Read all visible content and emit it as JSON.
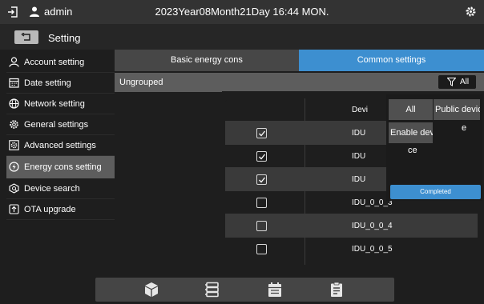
{
  "topbar": {
    "user": "admin",
    "datetime": "2023Year08Month21Day 16:44 MON."
  },
  "header": {
    "title": "Setting"
  },
  "sidebar": {
    "items": [
      {
        "label": "Account setting",
        "icon": "user-icon"
      },
      {
        "label": "Date setting",
        "icon": "calendar-icon"
      },
      {
        "label": "Network setting",
        "icon": "globe-icon"
      },
      {
        "label": "General settings",
        "icon": "gear-icon"
      },
      {
        "label": "Advanced settings",
        "icon": "advanced-gear-icon"
      },
      {
        "label": "Energy cons setting",
        "icon": "energy-icon",
        "active": true
      },
      {
        "label": "Device search",
        "icon": "device-search-icon"
      },
      {
        "label": "OTA upgrade",
        "icon": "upload-icon"
      }
    ]
  },
  "tabs": {
    "basic": "Basic energy cons",
    "common": "Common settings"
  },
  "groups": {
    "ungrouped": "Ungrouped"
  },
  "filter": {
    "label": "All"
  },
  "table": {
    "header": "Devi",
    "rows": [
      {
        "name": "IDU",
        "checked": true
      },
      {
        "name": "IDU",
        "checked": true
      },
      {
        "name": "IDU",
        "checked": true
      },
      {
        "name": "IDU_0_0_3",
        "checked": false
      },
      {
        "name": "IDU_0_0_4",
        "checked": false
      },
      {
        "name": "IDU_0_0_5",
        "checked": false
      }
    ]
  },
  "popup": {
    "all": "All",
    "public_line1": "Public devic",
    "public_line2": "e",
    "enable_line1": "Enable devi",
    "enable_line2": "ce",
    "completed": "Completed"
  },
  "dock": {
    "icons": [
      "cube-icon",
      "server-icon",
      "calendar-icon",
      "clipboard-icon"
    ]
  },
  "colors": {
    "accent": "#3d8fd0",
    "active": "#5d5d5d",
    "background": "#1e1e1e"
  }
}
